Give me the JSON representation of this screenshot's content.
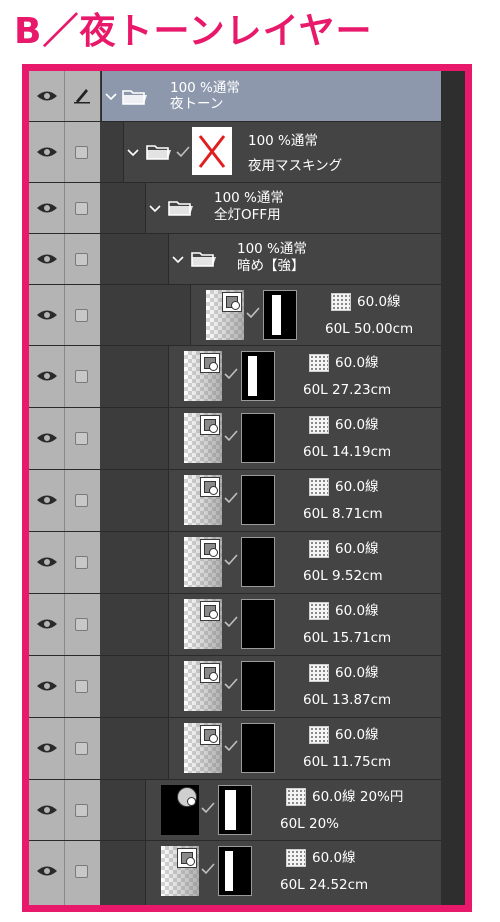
{
  "page_title": "B／夜トーンレイヤー",
  "layers": [
    {
      "kind": "folder",
      "blend": "100 %通常",
      "name": "夜トーン",
      "selected": true,
      "pen": true
    },
    {
      "kind": "folder-masked",
      "blend": "100 %通常",
      "name": "夜用マスキング"
    },
    {
      "kind": "folder",
      "blend": "100 %通常",
      "name": "全灯OFF用"
    },
    {
      "kind": "folder",
      "blend": "100 %通常",
      "name": "暗め【強】"
    },
    {
      "kind": "tone",
      "tone": "60.0線",
      "name": "60L 50.00cm"
    },
    {
      "kind": "tone",
      "tone": "60.0線",
      "name": "60L 27.23cm"
    },
    {
      "kind": "tone",
      "tone": "60.0線",
      "name": "60L 14.19cm"
    },
    {
      "kind": "tone",
      "tone": "60.0線",
      "name": "60L 8.71cm"
    },
    {
      "kind": "tone",
      "tone": "60.0線",
      "name": "60L 9.52cm"
    },
    {
      "kind": "tone",
      "tone": "60.0線",
      "name": "60L 15.71cm"
    },
    {
      "kind": "tone",
      "tone": "60.0線",
      "name": "60L 13.87cm"
    },
    {
      "kind": "tone",
      "tone": "60.0線",
      "name": "60L 11.75cm"
    },
    {
      "kind": "tone",
      "tone": "60.0線 20%円",
      "name": "60L 20%"
    },
    {
      "kind": "tone",
      "tone": "60.0線",
      "name": "60L 24.52cm"
    }
  ],
  "colors": {
    "accent": "#e8196a",
    "selected_row": "#8e98ad",
    "panel": "#444444",
    "column": "#b4b4b4"
  },
  "icons": [
    "eye-icon",
    "pen-icon",
    "chevron-down-icon",
    "folder-icon",
    "checkmark-icon",
    "tone-icon"
  ]
}
